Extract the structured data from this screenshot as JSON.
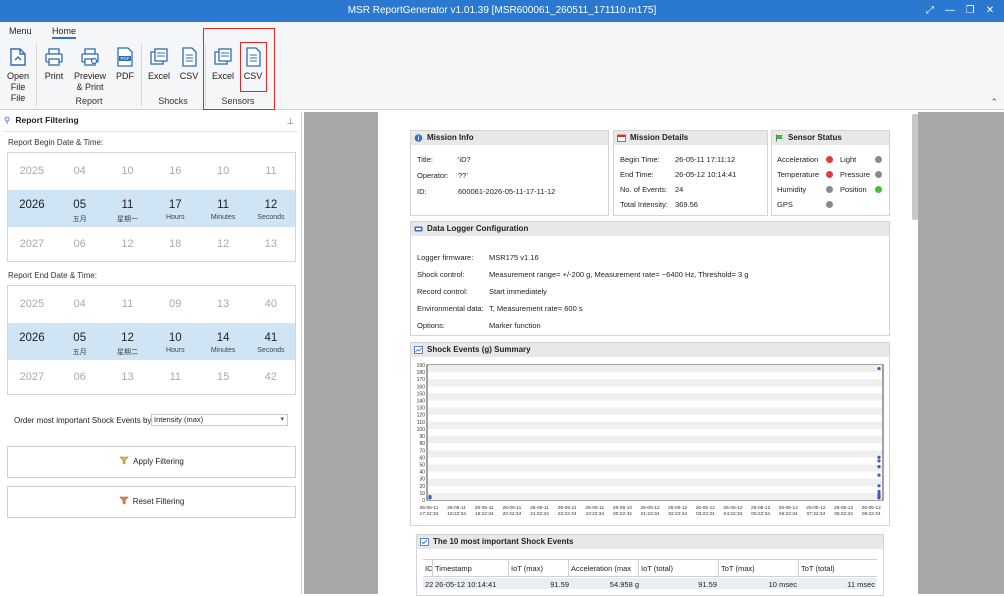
{
  "window": {
    "title": "MSR ReportGenerator v1.01.39 [MSR600061_260511_171110.m175]"
  },
  "ribbon": {
    "tabs": [
      {
        "label": "Menu"
      },
      {
        "label": "Home"
      }
    ],
    "buttons": {
      "open_file": "Open\nFile\nFile",
      "print": "Print",
      "preview_print": "Preview\n& Print",
      "pdf": "PDF",
      "shocks_excel": "Excel",
      "shocks_csv": "CSV",
      "sensors_excel": "Excel",
      "sensors_csv": "CSV"
    },
    "groups": {
      "report": "Report",
      "shocks": "Shocks",
      "sensors": "Sensors"
    }
  },
  "filter": {
    "title": "Report Filtering",
    "begin_label": "Report Begin Date & Time:",
    "end_label": "Report End Date & Time:",
    "begin": {
      "prev": [
        "2025",
        "04",
        "10",
        "16",
        "10",
        "11"
      ],
      "sel": [
        "2026",
        "05",
        "11",
        "17",
        "11",
        "12"
      ],
      "sub": [
        "",
        "五月",
        "星期一",
        "Hours",
        "Minutes",
        "Seconds"
      ],
      "next": [
        "2027",
        "06",
        "12",
        "18",
        "12",
        "13"
      ]
    },
    "end": {
      "prev": [
        "2025",
        "04",
        "11",
        "09",
        "13",
        "40"
      ],
      "sel": [
        "2026",
        "05",
        "12",
        "10",
        "14",
        "41"
      ],
      "sub": [
        "",
        "五月",
        "星期二",
        "Hours",
        "Minutes",
        "Seconds"
      ],
      "next": [
        "2027",
        "06",
        "13",
        "11",
        "15",
        "42"
      ]
    },
    "order_label": "Order most important Shock Events by:",
    "order_value": "Intensity (max)",
    "apply_label": "Apply Filtering",
    "reset_label": "Reset Filtering"
  },
  "report": {
    "mission_info": {
      "title": "Mission Info",
      "title_label": "Title:",
      "title_value": "'iD?",
      "operator_label": "Operator:",
      "operator_value": "??'",
      "id_label": "ID:",
      "id_value": "600061-2026-05-11-17-11-12"
    },
    "mission_details": {
      "title": "Mission Details",
      "begin_label": "Begin Time:",
      "begin_value": "26-05-11 17:11:12",
      "end_label": "End Time:",
      "end_value": "26-05-12 10:14:41",
      "events_label": "No. of Events:",
      "events_value": "24",
      "intensity_label": "Total Intensity:",
      "intensity_value": "369.56"
    },
    "sensor_status": {
      "title": "Sensor Status",
      "acceleration": "Acceleration",
      "light": "Light",
      "temperature": "Temperature",
      "pressure": "Pressure",
      "humidity": "Humidity",
      "position": "Position",
      "gps": "GPS",
      "colors": {
        "red": "#e23b3b",
        "gray": "#8a8a8a",
        "green": "#3fbf3f"
      }
    },
    "logger_config": {
      "title": "Data Logger Configuration",
      "firmware_label": "Logger firmware:",
      "firmware_value": "MSR175 v1.16",
      "shock_label": "Shock control:",
      "shock_value": "Measurement range= +/-200 g, Measurement rate= ~6400 Hz, Threshold= 3 g",
      "record_label": "Record control:",
      "record_value": "Start immediately",
      "env_label": "Environmental data:",
      "env_value": "T, Measurement rate= 600 s",
      "options_label": "Options:",
      "options_value": "Marker function"
    },
    "shock_summary": {
      "title": "Shock Events (g) Summary"
    },
    "top_events": {
      "title": "The 10 most important Shock Events",
      "columns": [
        "IC",
        "Timestamp",
        "IoT (max)",
        "Acceleration (max",
        "IoT (total)",
        "ToT (max)",
        "ToT (total)"
      ],
      "rows": [
        [
          "22",
          "26-05-12 10:14:41",
          "91.59",
          "54.958 g",
          "91.59",
          "10 msec",
          "11 msec"
        ]
      ]
    }
  },
  "chart_data": {
    "type": "scatter",
    "ylim": [
      0,
      190
    ],
    "yticks": [
      "190",
      "180",
      "170",
      "160",
      "150",
      "140",
      "130",
      "120",
      "110",
      "100",
      "90",
      "80",
      "70",
      "60",
      "50",
      "40",
      "30",
      "20",
      "10",
      "0"
    ],
    "xticks": [
      [
        "26-05-11",
        "17:22:34"
      ],
      [
        "26-05-11",
        "18:22:34"
      ],
      [
        "26-05-11",
        "19:22:34"
      ],
      [
        "26-05-11",
        "20:22:34"
      ],
      [
        "26-05-11",
        "21:22:34"
      ],
      [
        "26-05-11",
        "22:22:34"
      ],
      [
        "26-05-11",
        "23:22:34"
      ],
      [
        "26-05-12",
        "00:22:34"
      ],
      [
        "26-05-12",
        "01:22:34"
      ],
      [
        "26-05-12",
        "02:22:34"
      ],
      [
        "26-05-12",
        "03:22:34"
      ],
      [
        "26-05-12",
        "04:22:34"
      ],
      [
        "26-05-12",
        "05:22:34"
      ],
      [
        "26-05-12",
        "06:22:34"
      ],
      [
        "26-05-12",
        "07:22:34"
      ],
      [
        "26-05-12",
        "08:22:34"
      ],
      [
        "26-05-12",
        "09:22:34"
      ]
    ],
    "points": [
      {
        "x": "26-05-11 17:11:12",
        "y": 3
      },
      {
        "x": "26-05-11 17:11:30",
        "y": 5
      },
      {
        "x": "26-05-12 10:13:00",
        "y": 60
      },
      {
        "x": "26-05-12 10:13:10",
        "y": 55
      },
      {
        "x": "26-05-12 10:13:20",
        "y": 47
      },
      {
        "x": "26-05-12 10:13:30",
        "y": 35
      },
      {
        "x": "26-05-12 10:13:40",
        "y": 20
      },
      {
        "x": "26-05-12 10:13:50",
        "y": 12
      },
      {
        "x": "26-05-12 10:14:00",
        "y": 8
      },
      {
        "x": "26-05-12 10:14:10",
        "y": 5
      },
      {
        "x": "26-05-12 10:14:20",
        "y": 3
      },
      {
        "x": "26-05-12 10:14:41",
        "y": 185
      }
    ],
    "point_color": "#3a5bbf"
  }
}
